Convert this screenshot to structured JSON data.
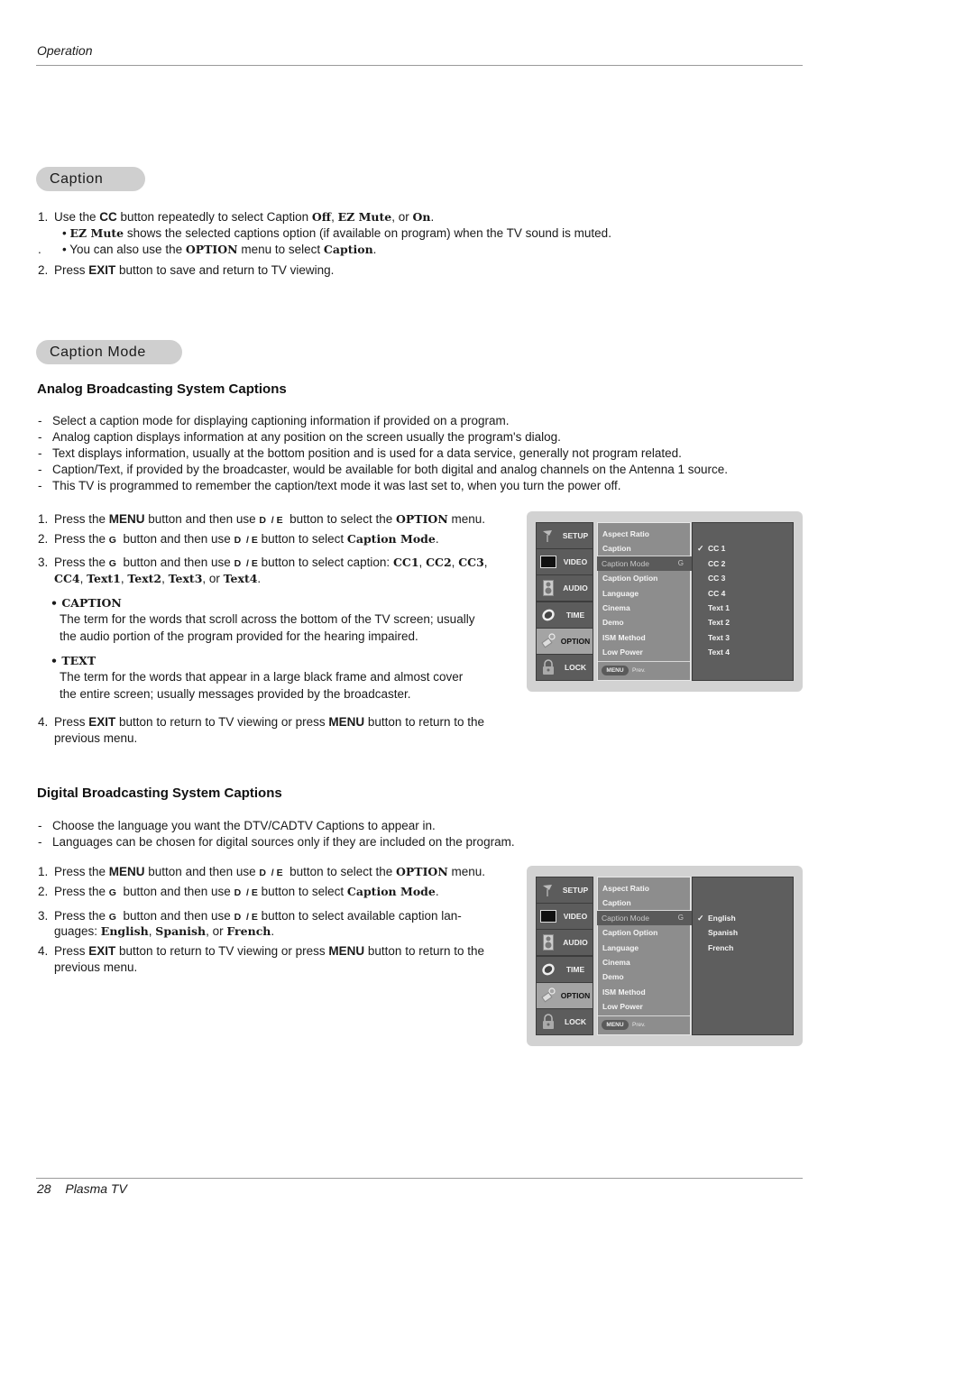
{
  "header": {
    "section": "Operation"
  },
  "caption_section": {
    "title": "Caption",
    "steps": [
      {
        "num": "1.",
        "parts": [
          {
            "t": "Use the ",
            "s": "n"
          },
          {
            "t": "CC",
            "s": "b"
          },
          {
            "t": " button repeatedly to select Caption ",
            "s": "n"
          },
          {
            "t": "Off",
            "s": "sb"
          },
          {
            "t": ", ",
            "s": "n"
          },
          {
            "t": "EZ Mute",
            "s": "sb"
          },
          {
            "t": ", or ",
            "s": "n"
          },
          {
            "t": "On",
            "s": "sb"
          },
          {
            "t": ".",
            "s": "n"
          }
        ]
      },
      {
        "num": "",
        "parts": [
          {
            "t": "• ",
            "s": "n"
          },
          {
            "t": "EZ Mute",
            "s": "sb"
          },
          {
            "t": " shows the selected captions option (if available on program) when the TV sound is muted.",
            "s": "n"
          }
        ]
      },
      {
        "num": ".",
        "parts": [
          {
            "t": "• You can also use the ",
            "s": "n"
          },
          {
            "t": "OPTION",
            "s": "sb"
          },
          {
            "t": " menu to select ",
            "s": "n"
          },
          {
            "t": "Caption",
            "s": "sb"
          },
          {
            "t": ".",
            "s": "n"
          }
        ]
      },
      {
        "num": "2.",
        "parts": [
          {
            "t": "Press ",
            "s": "n"
          },
          {
            "t": "EXIT",
            "s": "b"
          },
          {
            "t": " button to save and return to TV viewing.",
            "s": "n"
          }
        ]
      }
    ]
  },
  "caption_mode_section": {
    "title": "Caption Mode",
    "analog": {
      "heading": "Analog Broadcasting System Captions",
      "bullets": [
        "Select a caption mode for displaying captioning information if provided on a program.",
        "Analog caption displays information at any position on the screen usually the program's dialog.",
        "Text displays information, usually at the bottom position and is used for a data service, generally not program related.",
        "Caption/Text, if provided by the broadcaster, would be available for both digital and analog channels on the Antenna 1 source.",
        "This TV is programmed to remember the caption/text mode it was last set to, when you turn the power off."
      ],
      "steps": [
        {
          "num": "1.",
          "parts": [
            {
              "t": "Press the ",
              "s": "n"
            },
            {
              "t": "MENU",
              "s": "b"
            },
            {
              "t": " button and then use ",
              "s": "n"
            },
            {
              "t": "D  / E",
              "s": "k"
            },
            {
              "t": "  button to select the ",
              "s": "n"
            },
            {
              "t": "OPTION",
              "s": "sb"
            },
            {
              "t": " menu.",
              "s": "n"
            }
          ]
        },
        {
          "num": "2.",
          "parts": [
            {
              "t": "Press the ",
              "s": "n"
            },
            {
              "t": "G",
              "s": "k"
            },
            {
              "t": "  button and then use ",
              "s": "n"
            },
            {
              "t": "D  / E",
              "s": "k"
            },
            {
              "t": " button to select ",
              "s": "n"
            },
            {
              "t": "Caption Mode",
              "s": "sb"
            },
            {
              "t": ".",
              "s": "n"
            }
          ]
        },
        {
          "num": "3.",
          "parts": [
            {
              "t": "Press the ",
              "s": "n"
            },
            {
              "t": "G",
              "s": "k"
            },
            {
              "t": "  button and then use ",
              "s": "n"
            },
            {
              "t": "D  / E",
              "s": "k"
            },
            {
              "t": " button to select caption: ",
              "s": "n"
            },
            {
              "t": "CC1",
              "s": "sb"
            },
            {
              "t": ", ",
              "s": "n"
            },
            {
              "t": "CC2",
              "s": "sb"
            },
            {
              "t": ", ",
              "s": "n"
            },
            {
              "t": "CC3",
              "s": "sb"
            },
            {
              "t": ",",
              "s": "n"
            }
          ]
        },
        {
          "num": "",
          "parts": [
            {
              "t": "CC4",
              "s": "sb"
            },
            {
              "t": ", ",
              "s": "n"
            },
            {
              "t": "Text1",
              "s": "sb"
            },
            {
              "t": ", ",
              "s": "n"
            },
            {
              "t": "Text2",
              "s": "sb"
            },
            {
              "t": ", ",
              "s": "n"
            },
            {
              "t": "Text3",
              "s": "sb"
            },
            {
              "t": ", or ",
              "s": "n"
            },
            {
              "t": "Text4",
              "s": "sb"
            },
            {
              "t": ".",
              "s": "n"
            }
          ]
        }
      ],
      "terms": [
        {
          "term": "• CAPTION",
          "lines": [
            "The term for the words that scroll across the bottom of the TV screen; usually",
            "the audio portion of the program provided for the hearing impaired."
          ]
        },
        {
          "term": "• TEXT",
          "lines": [
            "The term for the words that appear in a large black frame and almost cover",
            "the entire screen; usually messages provided by the broadcaster."
          ]
        }
      ],
      "step4": {
        "num": "4.",
        "parts": [
          {
            "t": "Press ",
            "s": "n"
          },
          {
            "t": "EXIT",
            "s": "b"
          },
          {
            "t": " button to return to TV viewing or press ",
            "s": "n"
          },
          {
            "t": "MENU",
            "s": "b"
          },
          {
            "t": " button to return to the",
            "s": "n"
          }
        ],
        "cont": "previous menu."
      }
    },
    "digital": {
      "heading": "Digital Broadcasting System Captions",
      "bullets": [
        "Choose the language you want the DTV/CADTV Captions to appear in.",
        "Languages can be chosen for digital sources only if they are included on the program."
      ],
      "steps": [
        {
          "num": "1.",
          "parts": [
            {
              "t": "Press the ",
              "s": "n"
            },
            {
              "t": "MENU",
              "s": "b"
            },
            {
              "t": " button and then use ",
              "s": "n"
            },
            {
              "t": "D  / E",
              "s": "k"
            },
            {
              "t": "  button to select the ",
              "s": "n"
            },
            {
              "t": "OPTION",
              "s": "sb"
            },
            {
              "t": " menu.",
              "s": "n"
            }
          ]
        },
        {
          "num": "2.",
          "parts": [
            {
              "t": "Press the ",
              "s": "n"
            },
            {
              "t": "G",
              "s": "k"
            },
            {
              "t": "  button and then use ",
              "s": "n"
            },
            {
              "t": "D  / E",
              "s": "k"
            },
            {
              "t": " button to select ",
              "s": "n"
            },
            {
              "t": "Caption Mode",
              "s": "sb"
            },
            {
              "t": ".",
              "s": "n"
            }
          ]
        },
        {
          "num": "3.",
          "parts": [
            {
              "t": "Press the ",
              "s": "n"
            },
            {
              "t": "G",
              "s": "k"
            },
            {
              "t": "  button and then use ",
              "s": "n"
            },
            {
              "t": "D  / E",
              "s": "k"
            },
            {
              "t": " button to select available caption lan-",
              "s": "n"
            }
          ]
        },
        {
          "num": "",
          "parts": [
            {
              "t": "guages: ",
              "s": "n"
            },
            {
              "t": "English",
              "s": "sb"
            },
            {
              "t": ", ",
              "s": "n"
            },
            {
              "t": "Spanish",
              "s": "sb"
            },
            {
              "t": ", or ",
              "s": "n"
            },
            {
              "t": "French",
              "s": "sb"
            },
            {
              "t": ".",
              "s": "n"
            }
          ]
        },
        {
          "num": "4.",
          "parts": [
            {
              "t": "Press ",
              "s": "n"
            },
            {
              "t": "EXIT",
              "s": "b"
            },
            {
              "t": " button to return to TV viewing or press ",
              "s": "n"
            },
            {
              "t": "MENU",
              "s": "b"
            },
            {
              "t": " button to return to the",
              "s": "n"
            }
          ]
        },
        {
          "num": "",
          "parts": [
            {
              "t": "previous menu.",
              "s": "n"
            }
          ]
        }
      ]
    }
  },
  "osd_menus": [
    {
      "sidebar": [
        {
          "label": "SETUP",
          "icon": "satellite-dish-icon",
          "active": false
        },
        {
          "label": "VIDEO",
          "icon": "monitor-icon",
          "active": false
        },
        {
          "label": "AUDIO",
          "icon": "speaker-icon",
          "active": false
        },
        {
          "label": "TIME",
          "icon": "clock-icon",
          "active": false
        },
        {
          "label": "OPTION",
          "icon": "key-tag-icon",
          "active": true
        },
        {
          "label": "LOCK",
          "icon": "padlock-icon",
          "active": false
        }
      ],
      "items": [
        "Aspect Ratio",
        "Caption",
        "Caption Mode",
        "Caption Option",
        "Language",
        "Cinema",
        "Demo",
        "ISM Method",
        "Low Power"
      ],
      "selected_item": "Caption Mode",
      "arrow_glyph": "G",
      "menu_button": "MENU",
      "prev_label": "Prev.",
      "options": [
        "CC 1",
        "CC 2",
        "CC 3",
        "CC 4",
        "Text 1",
        "Text 2",
        "Text 3",
        "Text 4"
      ],
      "checked_option": "CC 1",
      "check_glyph": "✓"
    },
    {
      "sidebar": [
        {
          "label": "SETUP",
          "icon": "satellite-dish-icon",
          "active": false
        },
        {
          "label": "VIDEO",
          "icon": "monitor-icon",
          "active": false
        },
        {
          "label": "AUDIO",
          "icon": "speaker-icon",
          "active": false
        },
        {
          "label": "TIME",
          "icon": "clock-icon",
          "active": false
        },
        {
          "label": "OPTION",
          "icon": "key-tag-icon",
          "active": true
        },
        {
          "label": "LOCK",
          "icon": "padlock-icon",
          "active": false
        }
      ],
      "items": [
        "Aspect Ratio",
        "Caption",
        "Caption Mode",
        "Caption Option",
        "Language",
        "Cinema",
        "Demo",
        "ISM Method",
        "Low Power"
      ],
      "selected_item": "Caption Mode",
      "arrow_glyph": "G",
      "menu_button": "MENU",
      "prev_label": "Prev.",
      "options": [
        "English",
        "Spanish",
        "French"
      ],
      "checked_option": "English",
      "check_glyph": "✓"
    }
  ],
  "footer": {
    "page_number": "28",
    "product": "Plasma TV"
  }
}
